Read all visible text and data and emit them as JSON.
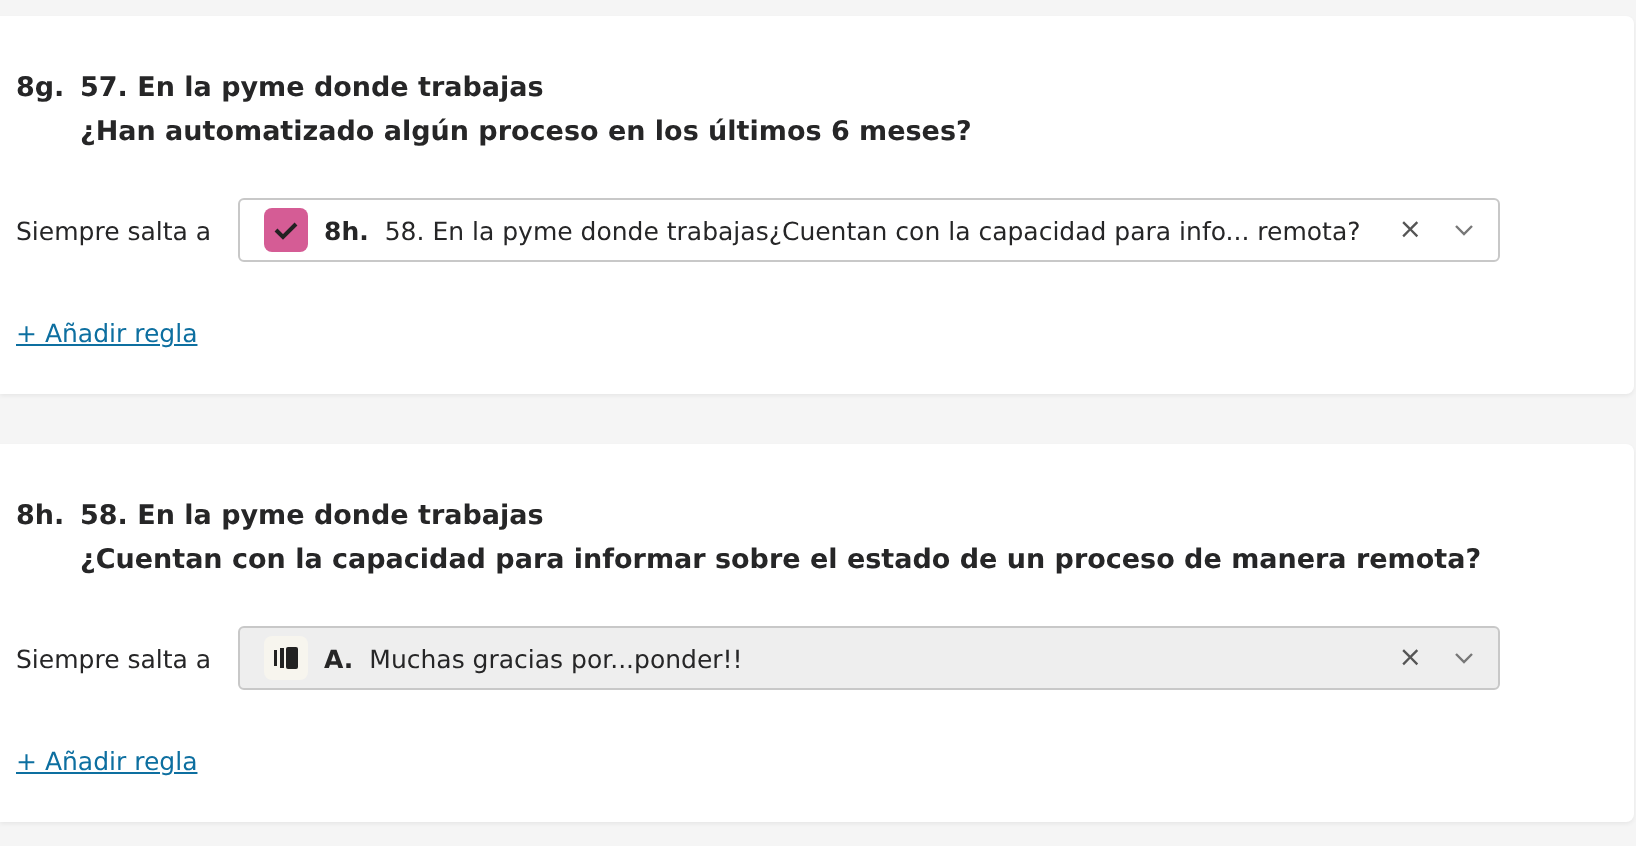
{
  "questions": [
    {
      "number": "8g.",
      "title": "57. En la pyme donde trabajas",
      "subtitle": "¿Han automatizado algún proceso en los últimos 6 meses?",
      "rule_label": "Siempre salta a",
      "target": {
        "kind": "question",
        "number": "8h.",
        "text": "58. En la pyme donde trabajas¿Cuentan con la capacidad para info... remota?",
        "clear": "×"
      },
      "add_rule": "+ Añadir regla"
    },
    {
      "number": "8h.",
      "title": "58. En la pyme donde trabajas",
      "subtitle": "¿Cuentan con la capacidad para informar sobre el estado de un proceso de manera remota?",
      "rule_label": "Siempre salta a",
      "target": {
        "kind": "ending",
        "number": "A.",
        "text": "Muchas gracias por...ponder!!",
        "clear": "×"
      },
      "add_rule": "+ Añadir regla"
    }
  ]
}
